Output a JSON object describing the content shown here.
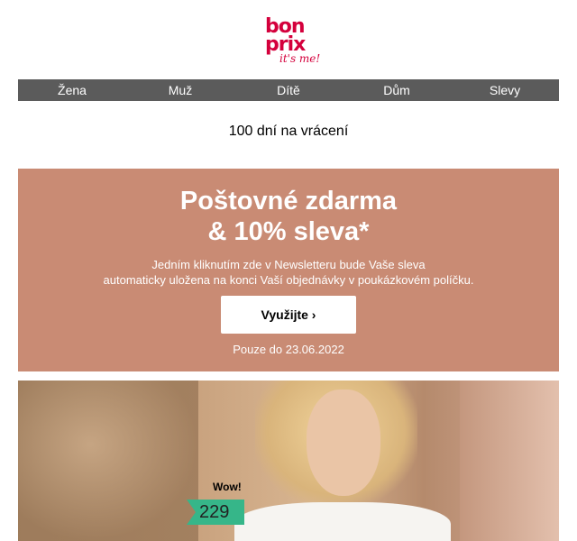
{
  "brand": {
    "line1": "bon",
    "line2": "prix",
    "tagline": "it's me!",
    "color": "#d4003c"
  },
  "nav": [
    "Žena",
    "Muž",
    "Dítě",
    "Dům",
    "Slevy"
  ],
  "returns": "100 dní na vrácení",
  "promo": {
    "title_line1": "Poštovné zdarma",
    "title_line2": "& 10% sleva*",
    "desc_line1": "Jedním kliknutím zde v Newsletteru bude Vaše sleva",
    "desc_line2": "automaticky uložena na konci Vaší objednávky v poukázkovém políčku.",
    "button": "Využijte ›",
    "until": "Pouze do 23.06.2022",
    "bg": "#c98b74"
  },
  "hero": {
    "wow": "Wow!",
    "price": "229",
    "price_tag_color": "#36b689"
  }
}
